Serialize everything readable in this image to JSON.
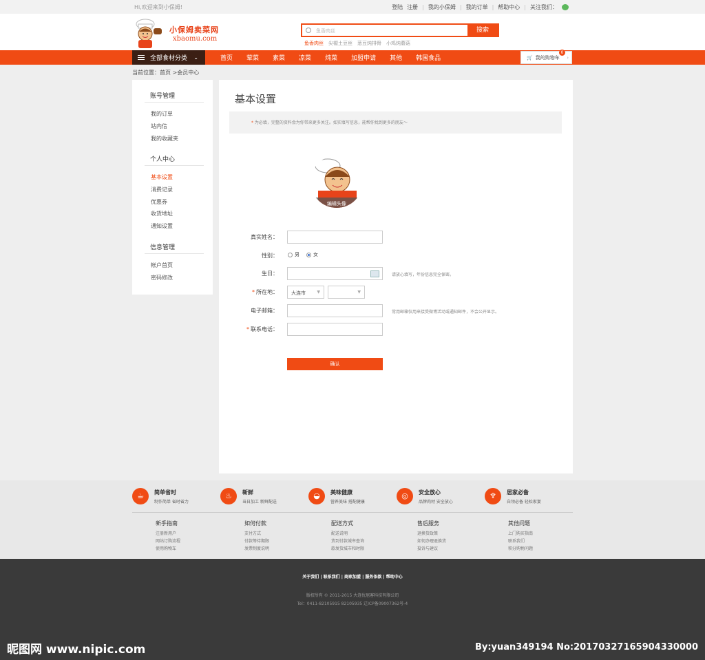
{
  "topbar": {
    "welcome": "Hi,欢迎来到小保姆!",
    "links": [
      "登陆",
      "注册",
      "我的小保姆",
      "我的订单",
      "帮助中心",
      "关注我们："
    ]
  },
  "logo": {
    "title": "小保姆卖菜网",
    "domain": "xbaomu.com"
  },
  "search": {
    "placeholder": "鱼香肉丝",
    "button": "搜索",
    "hot": [
      "鱼香肉丝",
      "尖椒土豆丝",
      "葱豆炖排骨",
      "小鸡炖蘑菇"
    ]
  },
  "nav": {
    "category": "全部食材分类",
    "items": [
      "首页",
      "荤菜",
      "素菜",
      "凉菜",
      "炖菜",
      "加盟申请",
      "其他",
      "韩国食品"
    ],
    "cart_label": "我的购物车",
    "cart_count": "0"
  },
  "breadcrumb": "当前位置：首页 >会员中心",
  "sidebar": {
    "groups": [
      {
        "title": "账号管理",
        "items": [
          "我的订单",
          "站内信",
          "我的收藏夹"
        ]
      },
      {
        "title": "个人中心",
        "items": [
          "基本设置",
          "消费记录",
          "优惠券",
          "收货地址",
          "通知设置"
        ]
      },
      {
        "title": "信息管理",
        "items": [
          "帐户首页",
          "密码修改"
        ]
      }
    ],
    "active": "基本设置"
  },
  "main": {
    "title": "基本设置",
    "notice": "为必填，完整的资料会为你带来更多关注。如实填写信息，能帮你找到更多的朋友～",
    "avatar_edit": "编辑头像",
    "form": {
      "name_label": "真实姓名：",
      "gender_label": "性别：",
      "male": "男",
      "female": "女",
      "gender_selected": "女",
      "birthday_label": "生日：",
      "birthday_hint": "请放心填写，年份信息完全保密。",
      "location_label": "所在地：",
      "city": "大连市",
      "district": "",
      "email_label": "电子邮箱：",
      "email_hint": "常用邮箱仅用来接受微博活动或通知邮件，不会公开显示。",
      "phone_label": "联系电话：",
      "submit": "确认"
    }
  },
  "features": [
    {
      "title": "简单省时",
      "sub": "制作简单 省时省力",
      "icon": "bowl-icon"
    },
    {
      "title": "新鲜",
      "sub": "当日加工 新鲜配送",
      "icon": "noodle-icon"
    },
    {
      "title": "美味健康",
      "sub": "营养美味 搭配健康",
      "icon": "dish-icon"
    },
    {
      "title": "安全放心",
      "sub": "品牌肉材 安全放心",
      "icon": "plate-icon"
    },
    {
      "title": "居家必备",
      "sub": "白领必备 轻松家宴",
      "icon": "cup-icon"
    }
  ],
  "footer_cols": [
    {
      "title": "新手指南",
      "items": [
        "注册新用户",
        "网站订购流程",
        "使用购物车"
      ]
    },
    {
      "title": "如何付款",
      "items": [
        "支付方式",
        "付款等待期限",
        "发票制度说明"
      ]
    },
    {
      "title": "配送方式",
      "items": [
        "配送说明",
        "货到付款城市查询",
        "款发货城市和时限"
      ]
    },
    {
      "title": "售后服务",
      "items": [
        "退换货政策",
        "如何办理退换货",
        "投诉与建议"
      ]
    },
    {
      "title": "其他问题",
      "items": [
        "上门购买指南",
        "联系我们",
        "积分购物问题"
      ]
    }
  ],
  "footer": {
    "links": "关于我们 | 联系我们 | 商家加盟 | 服务条款 | 帮助中心",
    "copyright": "版权所有 © 2011-2015 大连优居客科技有限公司",
    "contact": "Tel：0411-82105915 82105935 辽ICP备09007362号-4"
  },
  "watermark": {
    "left": "昵图网 www.nipic.com",
    "right": "By:yuan349194 No:20170327165904330000"
  },
  "colors": {
    "accent": "#f04b14",
    "dark": "#3b1f14",
    "footer": "#3a3a3a"
  }
}
